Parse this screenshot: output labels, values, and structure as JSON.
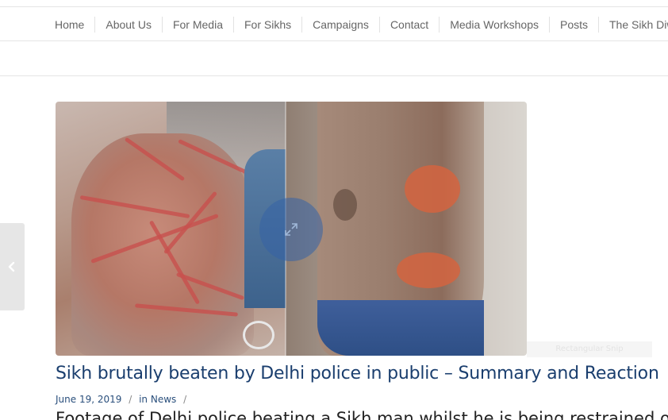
{
  "nav": {
    "items": [
      {
        "label": "Home"
      },
      {
        "label": "About Us"
      },
      {
        "label": "For Media"
      },
      {
        "label": "For Sikhs"
      },
      {
        "label": "Campaigns"
      },
      {
        "label": "Contact"
      },
      {
        "label": "Media Workshops"
      },
      {
        "label": "Posts"
      },
      {
        "label": "The Sikh Diwan"
      }
    ]
  },
  "image": {
    "caption": "Rectangular Snip"
  },
  "icons": {
    "zoom": "expand-arrows-icon",
    "prev": "chevron-left-icon"
  },
  "post": {
    "title": "Sikh brutally beaten by Delhi police in public – Summary and Reaction",
    "date": "June 19, 2019",
    "in_label": "in",
    "category": "News",
    "separator1": "/",
    "separator2": "/",
    "excerpt": "Footage of Delhi police beating a Sikh man whilst he is being restrained on the floor"
  },
  "colors": {
    "title": "#1a3e6e",
    "meta": "#2a4f7c",
    "zoom_overlay": "#3463a6"
  }
}
